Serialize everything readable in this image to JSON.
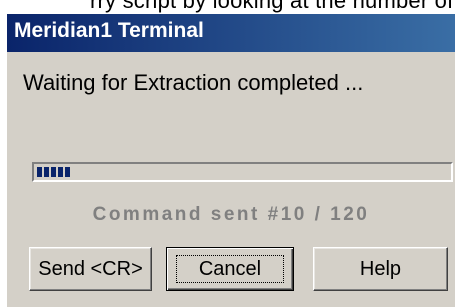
{
  "background_text": "rry script by looking at the number of th",
  "dialog": {
    "title": "Meridian1 Terminal",
    "message": "Waiting for Extraction completed ...",
    "progress": {
      "value": 10,
      "max": 120,
      "color": "#0a246a"
    },
    "status_text": "Command sent #10 / 120",
    "buttons": {
      "send_cr": "Send <CR>",
      "cancel": "Cancel",
      "help": "Help"
    }
  },
  "colors": {
    "title_bar_start": "#0a246a",
    "title_bar_end": "#3a6ea5",
    "dialog_face": "#d4d0c8",
    "status_text": "#808080"
  }
}
